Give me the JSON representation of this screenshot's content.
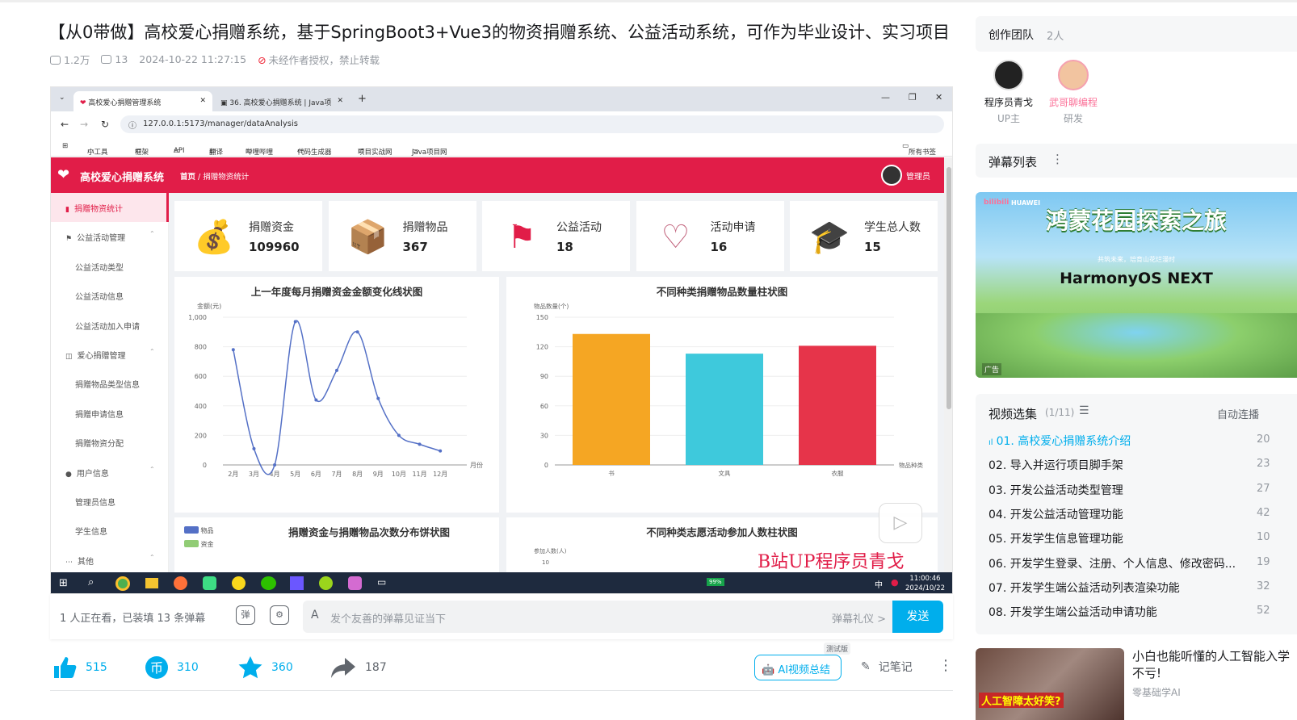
{
  "video": {
    "title": "【从0带做】高校爱心捐赠系统，基于SpringBoot3+Vue3的物资捐赠系统、公益活动系统，可作为毕业设计、实习项目",
    "views": "1.2万",
    "danmaku_count": "13",
    "datetime": "2024-10-22 11:27:15",
    "copyright_notice": "未经作者授权，禁止转载"
  },
  "screen": {
    "browser": {
      "tab1": "高校爱心捐赠管理系统",
      "tab2": "36. 高校爱心捐赠系统 | Java项",
      "url": "127.0.0.1:5173/manager/dataAnalysis",
      "bookmarks": [
        "小工具",
        "框架",
        "API",
        "翻译",
        "哔哩哔哩",
        "代码生成器",
        "项目实战网",
        "Java项目网"
      ],
      "all_bookmarks": "所有书签"
    },
    "app": {
      "name": "高校爱心捐赠系统",
      "breadcrumb_home": "首页",
      "breadcrumb_current": "捐赠物资统计",
      "user": "管理员"
    },
    "sidebar": [
      {
        "label": "捐赠物资统计",
        "type": "active"
      },
      {
        "label": "公益活动管理",
        "type": "group"
      },
      {
        "label": "公益活动类型",
        "type": "sub"
      },
      {
        "label": "公益活动信息",
        "type": "sub"
      },
      {
        "label": "公益活动加入申请",
        "type": "sub"
      },
      {
        "label": "爱心捐赠管理",
        "type": "group"
      },
      {
        "label": "捐赠物品类型信息",
        "type": "sub"
      },
      {
        "label": "捐赠申请信息",
        "type": "sub"
      },
      {
        "label": "捐赠物资分配",
        "type": "sub"
      },
      {
        "label": "用户信息",
        "type": "group"
      },
      {
        "label": "管理员信息",
        "type": "sub"
      },
      {
        "label": "学生信息",
        "type": "sub"
      },
      {
        "label": "其他",
        "type": "group"
      }
    ],
    "cards": [
      {
        "label": "捐赠资金",
        "value": "109960",
        "icon": "money-bag-icon"
      },
      {
        "label": "捐赠物品",
        "value": "367",
        "icon": "donation-box-icon"
      },
      {
        "label": "公益活动",
        "value": "18",
        "icon": "heart-flag-icon"
      },
      {
        "label": "活动申请",
        "value": "16",
        "icon": "hand-heart-icon"
      },
      {
        "label": "学生总人数",
        "value": "15",
        "icon": "graduation-cap-icon"
      }
    ],
    "watermark": "B站UP程序员青戈",
    "clock_time": "11:00:46",
    "clock_date": "2024/10/22",
    "battery": "99%",
    "ime": "中"
  },
  "chart_data": [
    {
      "type": "line",
      "title": "上一年度每月捐赠资金金额变化线状图",
      "ylabel": "金额(元)",
      "xlabel": "月份",
      "categories": [
        "2月",
        "3月",
        "4月",
        "5月",
        "6月",
        "7月",
        "8月",
        "9月",
        "10月",
        "11月",
        "12月"
      ],
      "values": [
        780,
        110,
        0,
        970,
        440,
        640,
        900,
        450,
        200,
        140,
        95
      ],
      "ylim": [
        0,
        1000
      ],
      "yticks": [
        0,
        200,
        400,
        600,
        800,
        "1,000"
      ],
      "color": "#5470c6"
    },
    {
      "type": "bar",
      "title": "不同种类捐赠物品数量柱状图",
      "ylabel": "物品数量(个)",
      "xlabel": "物品种类",
      "categories": [
        "书",
        "文具",
        "衣服"
      ],
      "values": [
        133,
        113,
        121
      ],
      "colors": [
        "#f5a623",
        "#3ec9dc",
        "#e6344a"
      ],
      "ylim": [
        0,
        150
      ],
      "yticks": [
        0,
        30,
        60,
        90,
        120,
        150
      ]
    },
    {
      "type": "pie",
      "title": "捐赠资金与捐赠物品次数分布饼状图",
      "legend": [
        {
          "name": "物品",
          "color": "#5470c6"
        },
        {
          "name": "资金",
          "color": "#91cc75"
        }
      ]
    },
    {
      "type": "bar",
      "title": "不同种类志愿活动参加人数柱状图",
      "ylabel": "参加人数(人)",
      "yticks": [
        10
      ]
    }
  ],
  "danmaku_bar": {
    "info": "1 人正在看，已装填 13 条弹幕",
    "placeholder": "发个友善的弹幕见证当下",
    "etiquette": "弹幕礼仪 >",
    "send": "发送"
  },
  "toolbar": {
    "likes": "515",
    "coins": "310",
    "favorites": "360",
    "shares": "187",
    "ai_summary": "AI视频总结",
    "ai_badge": "测试版",
    "notes": "记笔记"
  },
  "team": {
    "label": "创作团队",
    "count": "2人",
    "members": [
      {
        "name": "程序员青戈",
        "role": "UP主"
      },
      {
        "name": "武哥聊编程",
        "role": "研发"
      }
    ]
  },
  "danmaku_list": {
    "label": "弹幕列表"
  },
  "ad": {
    "brand": "HUAWEI",
    "title": "鸿蒙花园探索之旅",
    "subtitle": "共筑未来，培育山花烂漫时",
    "product": "HarmonyOS NEXT",
    "tag": "广告"
  },
  "playlist": {
    "label": "视频选集",
    "progress": "(1/11)",
    "autoplay": "自动连播",
    "episodes": [
      {
        "title": "01. 高校爱心捐赠系统介绍",
        "dur": "20"
      },
      {
        "title": "02. 导入并运行项目脚手架",
        "dur": "23"
      },
      {
        "title": "03. 开发公益活动类型管理",
        "dur": "27"
      },
      {
        "title": "04. 开发公益活动管理功能",
        "dur": "42"
      },
      {
        "title": "05. 开发学生信息管理功能",
        "dur": "10"
      },
      {
        "title": "06. 开发学生登录、注册、个人信息、修改密码...",
        "dur": "19"
      },
      {
        "title": "07. 开发学生端公益活动列表渲染功能",
        "dur": "32"
      },
      {
        "title": "08. 开发学生端公益活动申请功能",
        "dur": "52"
      }
    ]
  },
  "recommend": {
    "title": "小白也能听懂的人工智能入学不亏!",
    "author": "零基础学AI",
    "thumb_text": "人工智障太好笑?"
  }
}
